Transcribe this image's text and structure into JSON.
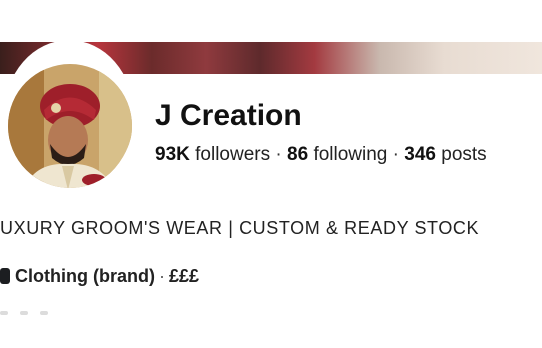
{
  "profile": {
    "name": "J Creation",
    "followers_count": "93K",
    "followers_label": "followers",
    "following_count": "86",
    "following_label": "following",
    "posts_count": "346",
    "posts_label": "posts",
    "separator": "·"
  },
  "bio": {
    "text": "UXURY GROOM'S WEAR | CUSTOM & READY STOCK"
  },
  "category": {
    "label": "Clothing (brand)",
    "separator": "·",
    "price": "£££",
    "icon": "bag-icon"
  },
  "colors": {
    "accent": "#b8353d",
    "text": "#1c1e21"
  }
}
